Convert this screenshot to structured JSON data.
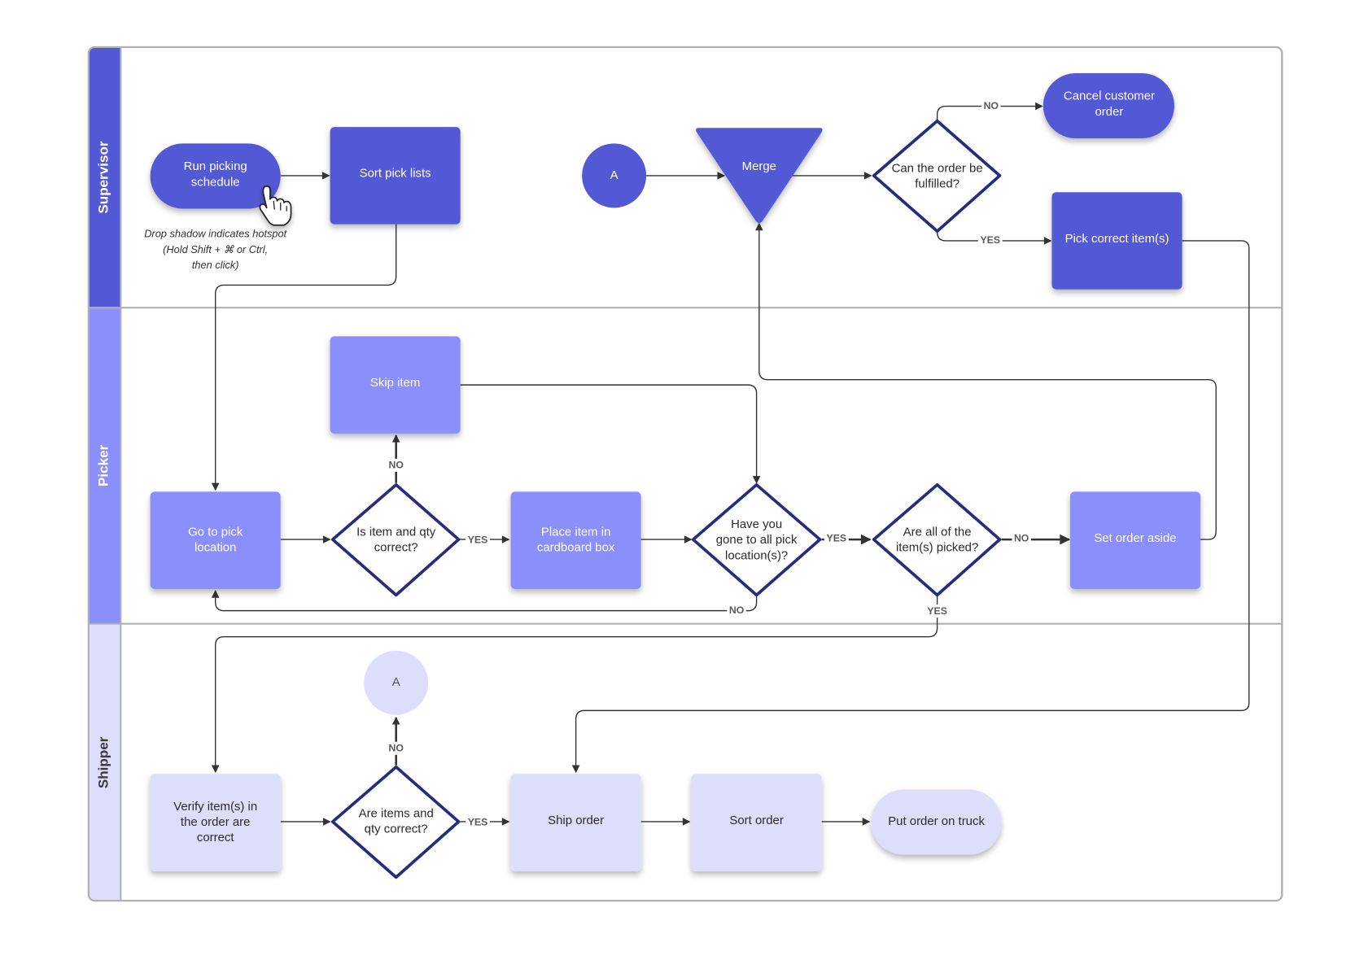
{
  "colors": {
    "supervisor": "#5359d4",
    "picker": "#8a8ffb",
    "shipper": "#dddefb",
    "decision_border": "#262d7a",
    "connector": "#333333",
    "frame": "#b0b0b0"
  },
  "lanes": [
    {
      "id": "supervisor",
      "title": "Supervisor"
    },
    {
      "id": "picker",
      "title": "Picker"
    },
    {
      "id": "shipper",
      "title": "Shipper"
    }
  ],
  "note": {
    "line1": "Drop shadow indicates hotspot",
    "line2": "(Hold Shift + ⌘ or Ctrl,",
    "line3": "then click)"
  },
  "nodes": {
    "run_picking": {
      "lines": [
        "Run picking",
        "schedule"
      ],
      "type": "terminator",
      "lane": "supervisor"
    },
    "sort_pick_lists": {
      "lines": [
        "Sort pick lists"
      ],
      "type": "process",
      "lane": "supervisor"
    },
    "connector_a_top": {
      "lines": [
        "A"
      ],
      "type": "connector",
      "lane": "supervisor"
    },
    "merge": {
      "lines": [
        "Merge"
      ],
      "type": "merge",
      "lane": "supervisor"
    },
    "can_fulfill": {
      "lines": [
        "Can the order be",
        "fulfilled?"
      ],
      "type": "decision",
      "lane": "supervisor"
    },
    "cancel_order": {
      "lines": [
        "Cancel customer",
        "order"
      ],
      "type": "terminator",
      "lane": "supervisor"
    },
    "pick_correct": {
      "lines": [
        "Pick correct item(s)"
      ],
      "type": "process",
      "lane": "supervisor"
    },
    "skip_item": {
      "lines": [
        "Skip item"
      ],
      "type": "process",
      "lane": "picker"
    },
    "go_to_pick": {
      "lines": [
        "Go to pick",
        "location"
      ],
      "type": "process",
      "lane": "picker"
    },
    "item_qty_correct": {
      "lines": [
        "Is item and qty",
        "correct?"
      ],
      "type": "decision",
      "lane": "picker"
    },
    "place_item": {
      "lines": [
        "Place item in",
        "cardboard box"
      ],
      "type": "process",
      "lane": "picker"
    },
    "all_locations": {
      "lines": [
        "Have you",
        "gone to all pick",
        "location(s)?"
      ],
      "type": "decision",
      "lane": "picker"
    },
    "all_picked": {
      "lines": [
        "Are all of the",
        "item(s) picked?"
      ],
      "type": "decision",
      "lane": "picker"
    },
    "set_aside": {
      "lines": [
        "Set order aside"
      ],
      "type": "process",
      "lane": "picker"
    },
    "connector_a_bottom": {
      "lines": [
        "A"
      ],
      "type": "connector",
      "lane": "shipper"
    },
    "verify_items": {
      "lines": [
        "Verify item(s) in",
        "the order are",
        "correct"
      ],
      "type": "process",
      "lane": "shipper"
    },
    "items_qty_correct": {
      "lines": [
        "Are items and",
        "qty correct?"
      ],
      "type": "decision",
      "lane": "shipper"
    },
    "ship_order": {
      "lines": [
        "Ship order"
      ],
      "type": "process",
      "lane": "shipper"
    },
    "sort_order": {
      "lines": [
        "Sort order"
      ],
      "type": "process",
      "lane": "shipper"
    },
    "put_on_truck": {
      "lines": [
        "Put order on truck"
      ],
      "type": "terminator",
      "lane": "shipper"
    }
  },
  "edges": [
    {
      "from": "run_picking",
      "to": "sort_pick_lists",
      "label": ""
    },
    {
      "from": "sort_pick_lists",
      "to": "go_to_pick",
      "label": ""
    },
    {
      "from": "connector_a_top",
      "to": "merge",
      "label": ""
    },
    {
      "from": "merge",
      "to": "can_fulfill",
      "label": ""
    },
    {
      "from": "can_fulfill",
      "to": "cancel_order",
      "label": "NO"
    },
    {
      "from": "can_fulfill",
      "to": "pick_correct",
      "label": "YES"
    },
    {
      "from": "pick_correct",
      "to": "ship_order",
      "label": ""
    },
    {
      "from": "go_to_pick",
      "to": "item_qty_correct",
      "label": ""
    },
    {
      "from": "item_qty_correct",
      "to": "skip_item",
      "label": "NO"
    },
    {
      "from": "item_qty_correct",
      "to": "place_item",
      "label": "YES"
    },
    {
      "from": "skip_item",
      "to": "all_locations",
      "label": ""
    },
    {
      "from": "place_item",
      "to": "all_locations",
      "label": ""
    },
    {
      "from": "all_locations",
      "to": "all_picked",
      "label": "YES"
    },
    {
      "from": "all_locations",
      "to": "go_to_pick",
      "label": "NO"
    },
    {
      "from": "all_picked",
      "to": "set_aside",
      "label": "NO"
    },
    {
      "from": "all_picked",
      "to": "verify_items",
      "label": "YES"
    },
    {
      "from": "set_aside",
      "to": "merge",
      "label": ""
    },
    {
      "from": "verify_items",
      "to": "items_qty_correct",
      "label": ""
    },
    {
      "from": "items_qty_correct",
      "to": "connector_a_bottom",
      "label": "NO"
    },
    {
      "from": "items_qty_correct",
      "to": "ship_order",
      "label": "YES"
    },
    {
      "from": "ship_order",
      "to": "sort_order",
      "label": ""
    },
    {
      "from": "sort_order",
      "to": "put_on_truck",
      "label": ""
    }
  ]
}
